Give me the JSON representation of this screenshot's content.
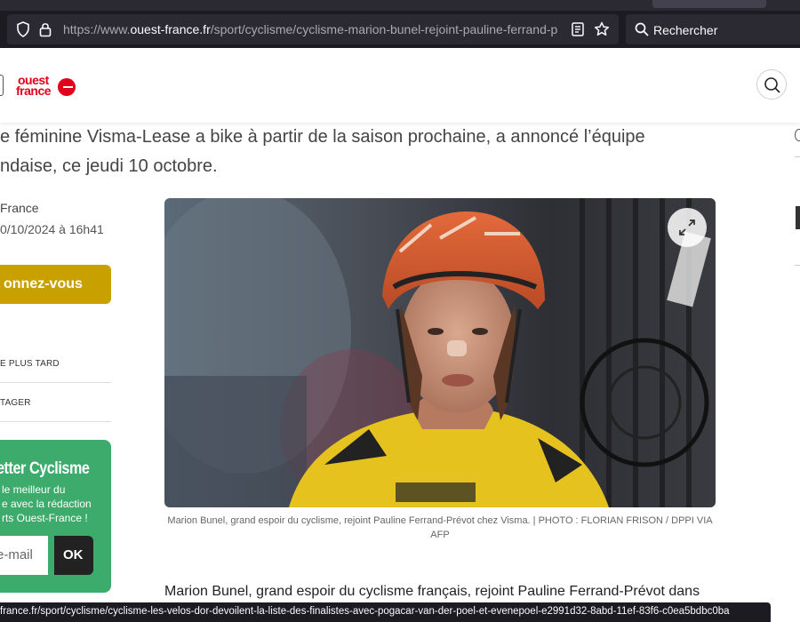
{
  "browser": {
    "url_prefix": "https://www.",
    "url_domain": "ouest-france.fr",
    "url_path": "/sport/cyclisme/cyclisme-marion-bunel-rejoint-pauline-ferrand-p",
    "search_placeholder": "Rechercher"
  },
  "site": {
    "logo_line1": "ouest",
    "logo_line2": "france"
  },
  "article": {
    "intro_line1": "e féminine Visma-Lease a bike à partir de la saison prochaine, a annoncé l’équipe",
    "intro_line2": "ndaise, ce jeudi 10 octobre.",
    "byline": "France",
    "date": "0/10/2024 à 16h41",
    "photo_caption": "Marion Bunel, grand espoir du cyclisme, rejoint Pauline Ferrand-Prévot chez Visma. | PHOTO : FLORIAN FRISON / DPPI VIA AFP",
    "body_start": "Marion Bunel, grand espoir du cyclisme français, rejoint Pauline Ferrand-Prévot dans"
  },
  "sidebar": {
    "subscribe_label": "onnez-vous",
    "read_later_label": "E PLUS TARD",
    "share_label": "TAGER",
    "newsletter_title": "etter Cyclisme",
    "newsletter_text_1": "le meilleur du",
    "newsletter_text_2": "e avec la rédaction",
    "newsletter_text_3": "rts Ouest-France !",
    "email_placeholder": "e-mail",
    "ok_label": "OK"
  },
  "status_bar": {
    "link": "france.fr/sport/cyclisme/cyclisme-les-velos-dor-devoilent-la-liste-des-finalistes-avec-pogacar-van-der-poel-et-evenepoel-e2991d32-8abd-11ef-83f6-c0ea5bdbc0ba"
  },
  "colors": {
    "brand_red": "#e2001a",
    "subscribe_gold": "#c8a000",
    "newsletter_green": "#3cab6b"
  }
}
